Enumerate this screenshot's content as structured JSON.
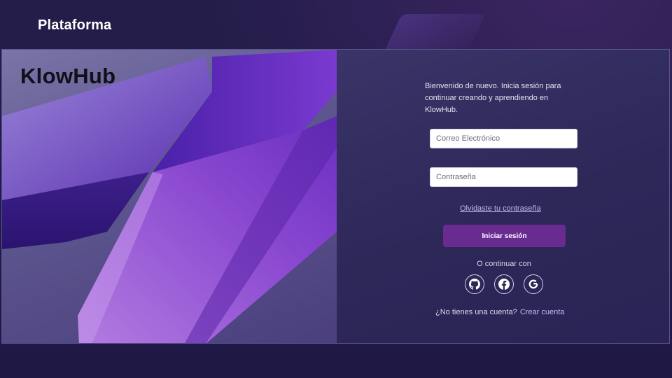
{
  "header": {
    "brand": "Plataforma"
  },
  "hero": {
    "logo": "KlowHub"
  },
  "login": {
    "welcome": "Bienvenido de nuevo. Inicia sesión para continuar creando y aprendiendo en KlowHub.",
    "email_placeholder": "Correo Electrónico",
    "password_placeholder": "Contraseña",
    "forgot": "Olvidaste tu contraseña",
    "submit": "Iniciar sesión",
    "or_continue": "O continuar con",
    "social": [
      "github-icon",
      "facebook-icon",
      "google-icon"
    ],
    "no_account": "¿No tienes una cuenta?",
    "create_account": "Crear cuenta"
  },
  "colors": {
    "accent": "#6a2b91",
    "link": "#c4b8f2",
    "background": "#231c48"
  }
}
